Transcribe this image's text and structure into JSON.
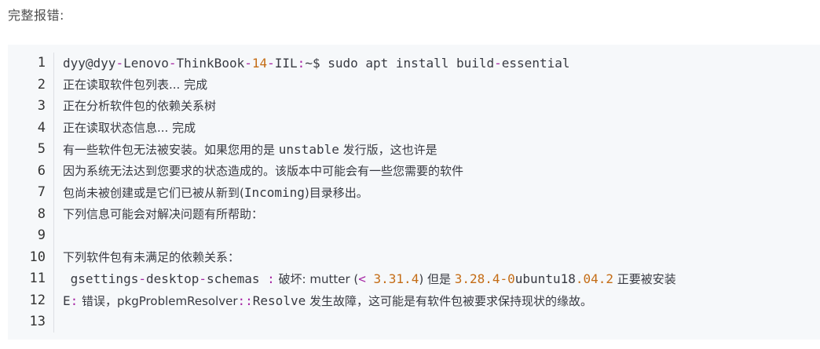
{
  "heading": "完整报错:",
  "colors": {
    "code_bg": "#f6f8fa",
    "text": "#383a42",
    "number": "#c46c15",
    "operator": "#a626a4"
  },
  "line_numbers": [
    "1",
    "2",
    "3",
    "4",
    "5",
    "6",
    "7",
    "8",
    "9",
    "10",
    "11",
    "12",
    "13"
  ],
  "lines": {
    "l1": {
      "a": "dyy@dyy",
      "b": "-",
      "c": "Lenovo",
      "d": "-",
      "e": "ThinkBook",
      "f": "-",
      "g": "14",
      "h": "-",
      "i": "IIL",
      "j": ":",
      "k": "~$ sudo apt install build",
      "l": "-",
      "m": "essential"
    },
    "l2": "正在读取软件包列表... 完成",
    "l3": "正在分析软件包的依赖关系树",
    "l4": "正在读取状态信息... 完成",
    "l5": {
      "a": "有一些软件包无法被安装。如果您用的是 ",
      "b": "unstable",
      "c": " 发行版，这也许是"
    },
    "l6": "因为系统无法达到您要求的状态造成的。该版本中可能会有一些您需要的软件",
    "l7": {
      "a": "包尚未被创建或是它们已被从新到(",
      "b": "Incoming",
      "c": ")目录移出。"
    },
    "l8": "下列信息可能会对解决问题有所帮助：",
    "l9": "",
    "l10": "下列软件包有未满足的依赖关系：",
    "l11": {
      "a": " gsettings",
      "b": "-",
      "c": "desktop",
      "d": "-",
      "e": "schemas ",
      "f": ":",
      "g": " 破坏: mutter (",
      "h": "<",
      "i": " 3.31.4",
      "j": ") 但是 ",
      "k": "3.28.4-0",
      "l": "ubuntu18",
      "m": ".04.2",
      "n": " 正要被安装"
    },
    "l12": {
      "a": "E",
      "b": ":",
      "c": " 错误，pkgProblemResolver",
      "d": "::",
      "e": "Resolve",
      "f": " 发生故障，这可能是有软件包被要求保持现状的缘故。"
    },
    "l13": ""
  }
}
